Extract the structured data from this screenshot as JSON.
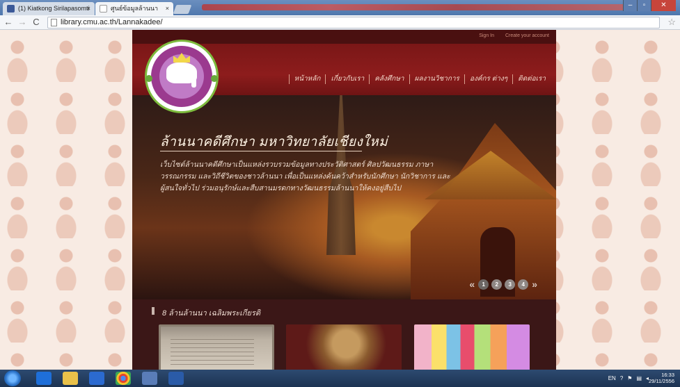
{
  "browser": {
    "tabs": [
      {
        "title": "(1) Kiatkong Sirilapasomti",
        "active": false
      },
      {
        "title": "ศูนย์ข้อมูลล้านนา",
        "active": true
      }
    ],
    "url": "library.cmu.ac.th/Lannakadee/"
  },
  "site": {
    "top_links": {
      "sign_in": "Sign In",
      "create_account": "Create your account"
    },
    "nav": [
      "หน้าหลัก",
      "เกี่ยวกับเรา",
      "คลังศึกษา",
      "ผลงานวิชาการ",
      "องค์กร ต่างๆ",
      "ติดต่อเรา"
    ],
    "hero": {
      "title": "ล้านนาคดีศึกษา มหาวิทยาลัยเชียงใหม่",
      "body": "เว็บไซต์ล้านนาคดีศึกษาเป็นแหล่งรวบรวมข้อมูลทางประวัติศาสตร์ ศิลปวัฒนธรรม ภาษา วรรณกรรม และวิถีชีวิตของชาวล้านนา เพื่อเป็นแหล่งค้นคว้าสำหรับนักศึกษา นักวิชาการ และผู้สนใจทั่วไป ร่วมอนุรักษ์และสืบสานมรดกทางวัฒนธรรมล้านนาให้คงอยู่สืบไป",
      "slides": [
        "1",
        "2",
        "3",
        "4"
      ],
      "active_slide": "1",
      "prev": "«",
      "next": "»"
    },
    "collection": {
      "title": "8 ล้านล้านนา เฉลิมพระเกียรติ"
    }
  },
  "taskbar": {
    "lang": "EN",
    "time": "16:33",
    "date": "29/11/2556"
  }
}
